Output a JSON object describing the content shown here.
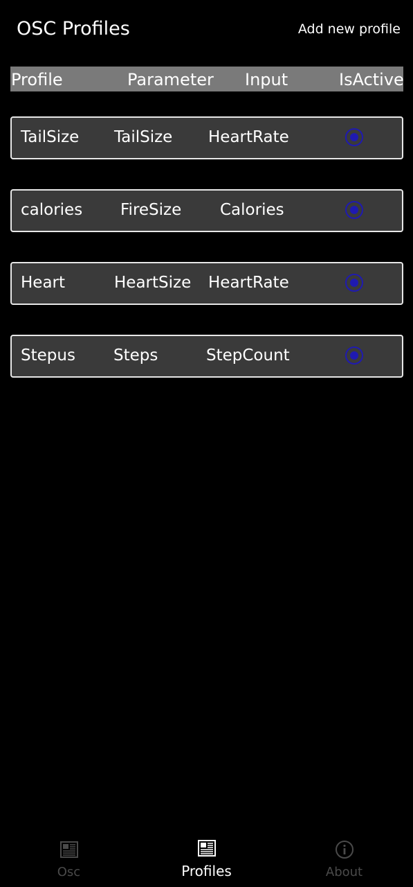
{
  "header": {
    "title": "OSC Profiles",
    "add_label": "Add new profile"
  },
  "columns": {
    "profile": "Profile",
    "parameter": "Parameter",
    "input": "Input",
    "is_active": "IsActive"
  },
  "profiles": [
    {
      "profile": "TailSize",
      "parameter": "TailSize",
      "input": "HeartRate",
      "active": true
    },
    {
      "profile": "calories",
      "parameter": "FireSize",
      "input": "Calories",
      "active": true
    },
    {
      "profile": "Heart",
      "parameter": "HeartSize",
      "input": "HeartRate",
      "active": true
    },
    {
      "profile": "Stepus",
      "parameter": "Steps",
      "input": "StepCount",
      "active": true
    }
  ],
  "nav": {
    "items": [
      {
        "label": "Osc",
        "icon": "news-icon",
        "active": false
      },
      {
        "label": "Profiles",
        "icon": "news-icon",
        "active": true
      },
      {
        "label": "About",
        "icon": "info-icon",
        "active": false
      }
    ]
  },
  "colors": {
    "background": "#000000",
    "row_background": "#3a3a3a",
    "header_bar": "#7a7a7a",
    "radio_accent": "#1f1ab0",
    "inactive_nav": "#4a4a4a"
  }
}
